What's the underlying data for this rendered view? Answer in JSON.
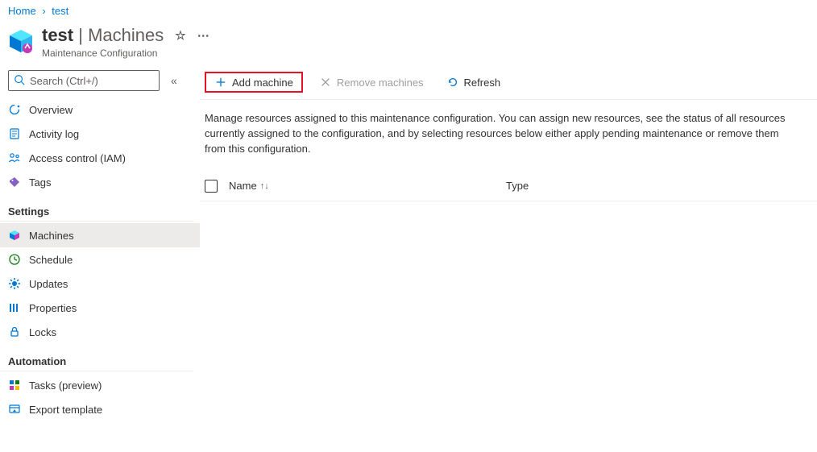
{
  "breadcrumb": {
    "home": "Home",
    "current": "test"
  },
  "header": {
    "resource_name": "test",
    "section": "Machines",
    "subtitle": "Maintenance Configuration"
  },
  "search": {
    "placeholder": "Search (Ctrl+/)"
  },
  "nav": {
    "top": [
      {
        "key": "overview",
        "label": "Overview"
      },
      {
        "key": "activity-log",
        "label": "Activity log"
      },
      {
        "key": "access-control",
        "label": "Access control (IAM)"
      },
      {
        "key": "tags",
        "label": "Tags"
      }
    ],
    "settings_header": "Settings",
    "settings": [
      {
        "key": "machines",
        "label": "Machines",
        "selected": true
      },
      {
        "key": "schedule",
        "label": "Schedule"
      },
      {
        "key": "updates",
        "label": "Updates"
      },
      {
        "key": "properties",
        "label": "Properties"
      },
      {
        "key": "locks",
        "label": "Locks"
      }
    ],
    "automation_header": "Automation",
    "automation": [
      {
        "key": "tasks",
        "label": "Tasks (preview)"
      },
      {
        "key": "export-template",
        "label": "Export template"
      }
    ]
  },
  "toolbar": {
    "add_machine": "Add machine",
    "remove_machines": "Remove machines",
    "refresh": "Refresh"
  },
  "main": {
    "description": "Manage resources assigned to this maintenance configuration. You can assign new resources, see the status of all resources currently assigned to the configuration, and by selecting resources below either apply pending maintenance or remove them from this configuration."
  },
  "table": {
    "columns": {
      "name": "Name",
      "type": "Type"
    },
    "rows": []
  }
}
